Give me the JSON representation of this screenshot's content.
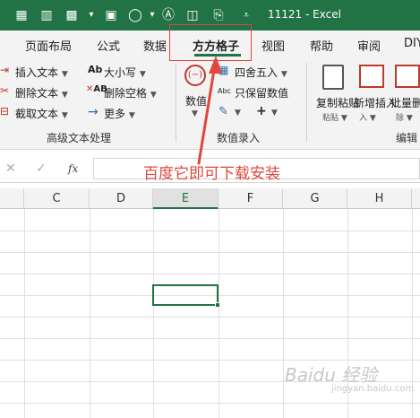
{
  "titlebar": {
    "title": "11121 - Excel",
    "colors": {
      "background": "#217346",
      "text": "#ffffff"
    },
    "icons": [
      "form-icon",
      "chart-icon",
      "qat-dropdown-icon",
      "screenshot-icon",
      "shapes-icon",
      "text-icon",
      "clipboard-icon",
      "customize-qat-icon"
    ]
  },
  "tabs": {
    "items": [
      "页面布局",
      "公式",
      "数据",
      "方方格子",
      "视图",
      "帮助",
      "审阅",
      "DIY"
    ],
    "active": "方方格子"
  },
  "ribbon": {
    "text_group": {
      "insert_text": "插入文本",
      "delete_text": "删除文本",
      "extract_text": "截取文本",
      "case": "大小写",
      "delete_spaces": "删除空格",
      "more": "更多",
      "label": "高级文本处理"
    },
    "number_group": {
      "numeric": "数值",
      "round": "四舍五入",
      "keep_number": "只保留数值",
      "label": "数值录入"
    },
    "edit_group": {
      "copy_paste": "复制粘贴",
      "batch_insert": "新增插入",
      "batch_delete": "批量删除",
      "label": "编辑"
    }
  },
  "formula_bar": {
    "cancel": "✕",
    "confirm": "✓",
    "fx": "fx",
    "value": ""
  },
  "grid": {
    "columns": [
      "C",
      "D",
      "E",
      "F",
      "G",
      "H"
    ],
    "selected_column": "E"
  },
  "annotation": {
    "text": "百度它即可下载安装",
    "color": "#e0463d"
  },
  "watermark": {
    "text": "Baidu 经验",
    "sub": "jingyan.baidu.com"
  }
}
